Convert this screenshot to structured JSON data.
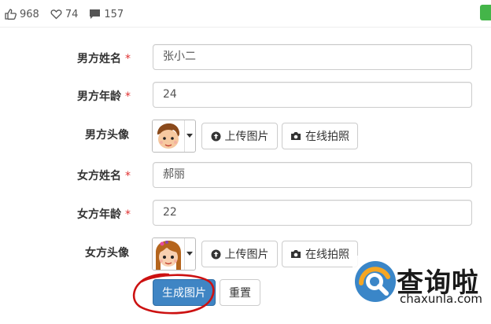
{
  "stats": {
    "likes": "968",
    "favorites": "74",
    "comments": "157"
  },
  "form": {
    "male_name": {
      "label": "男方姓名",
      "required": "*",
      "value": "张小二"
    },
    "male_age": {
      "label": "男方年龄",
      "required": "*",
      "value": "24"
    },
    "male_avatar": {
      "label": "男方头像",
      "upload": "上传图片",
      "camera": "在线拍照"
    },
    "female_name": {
      "label": "女方姓名",
      "required": "*",
      "value": "郝丽"
    },
    "female_age": {
      "label": "女方年龄",
      "required": "*",
      "value": "22"
    },
    "female_avatar": {
      "label": "女方头像",
      "upload": "上传图片",
      "camera": "在线拍照"
    },
    "generate": "生成图片",
    "reset": "重置"
  },
  "watermark": {
    "name": "查询啦",
    "url": "chaxunla.com"
  },
  "colors": {
    "primary": "#3f85c4",
    "required": "#e03030",
    "annotation": "#cc1111"
  },
  "icons": [
    "thumbs-up-icon",
    "heart-icon",
    "comment-icon",
    "upload-icon",
    "camera-icon",
    "chevron-down-icon"
  ]
}
